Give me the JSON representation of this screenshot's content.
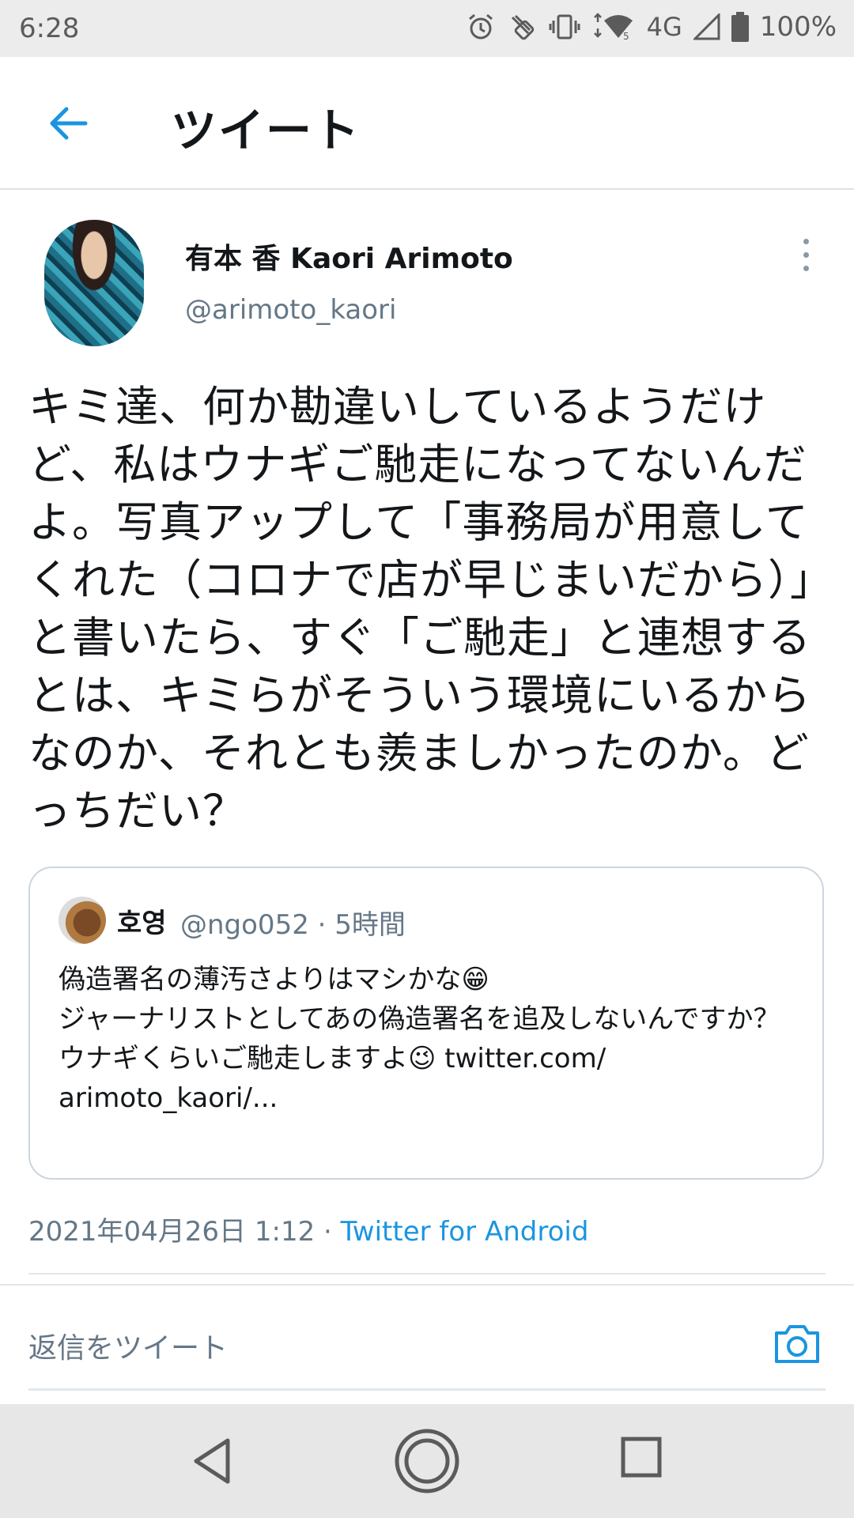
{
  "status_bar": {
    "time": "6:28",
    "network": "4G",
    "battery": "100%",
    "icons": [
      "alarm-icon",
      "nfc-icon",
      "vibrate-icon",
      "wifi-icon",
      "signal-icon",
      "battery-icon"
    ]
  },
  "header": {
    "title": "ツイート",
    "back_icon": "arrow-left-icon"
  },
  "tweet": {
    "author_name": "有本 香 Kaori Arimoto",
    "author_handle": "@arimoto_kaori",
    "text": "キミ達、何か勘違いしているようだけど、私はウナギご馳走になってないんだよ。写真アップして「事務局が用意してくれた（コロナで店が早じまいだから）」と書いたら、すぐ「ご馳走」と連想するとは、キミらがそういう環境にいるからなのか、それとも羨ましかったのか。どっちだい？",
    "date": "2021年04月26日 1:12 · ",
    "source": "Twitter for Android"
  },
  "quote": {
    "name": "호영",
    "meta": "@ngo052 · 5時間",
    "text": "偽造署名の薄汚さよりはマシかな😁\nジャーナリストとしてあの偽造署名を追及しないんですか？\nウナギくらいご馳走しますよ😉 twitter.com/\narimoto_kaori/..."
  },
  "reply": {
    "placeholder": "返信をツイート",
    "camera_icon": "camera-icon"
  },
  "colors": {
    "accent": "#1b95e0",
    "text": "#14171a",
    "secondary": "#657786",
    "border": "#ccd6dd"
  }
}
